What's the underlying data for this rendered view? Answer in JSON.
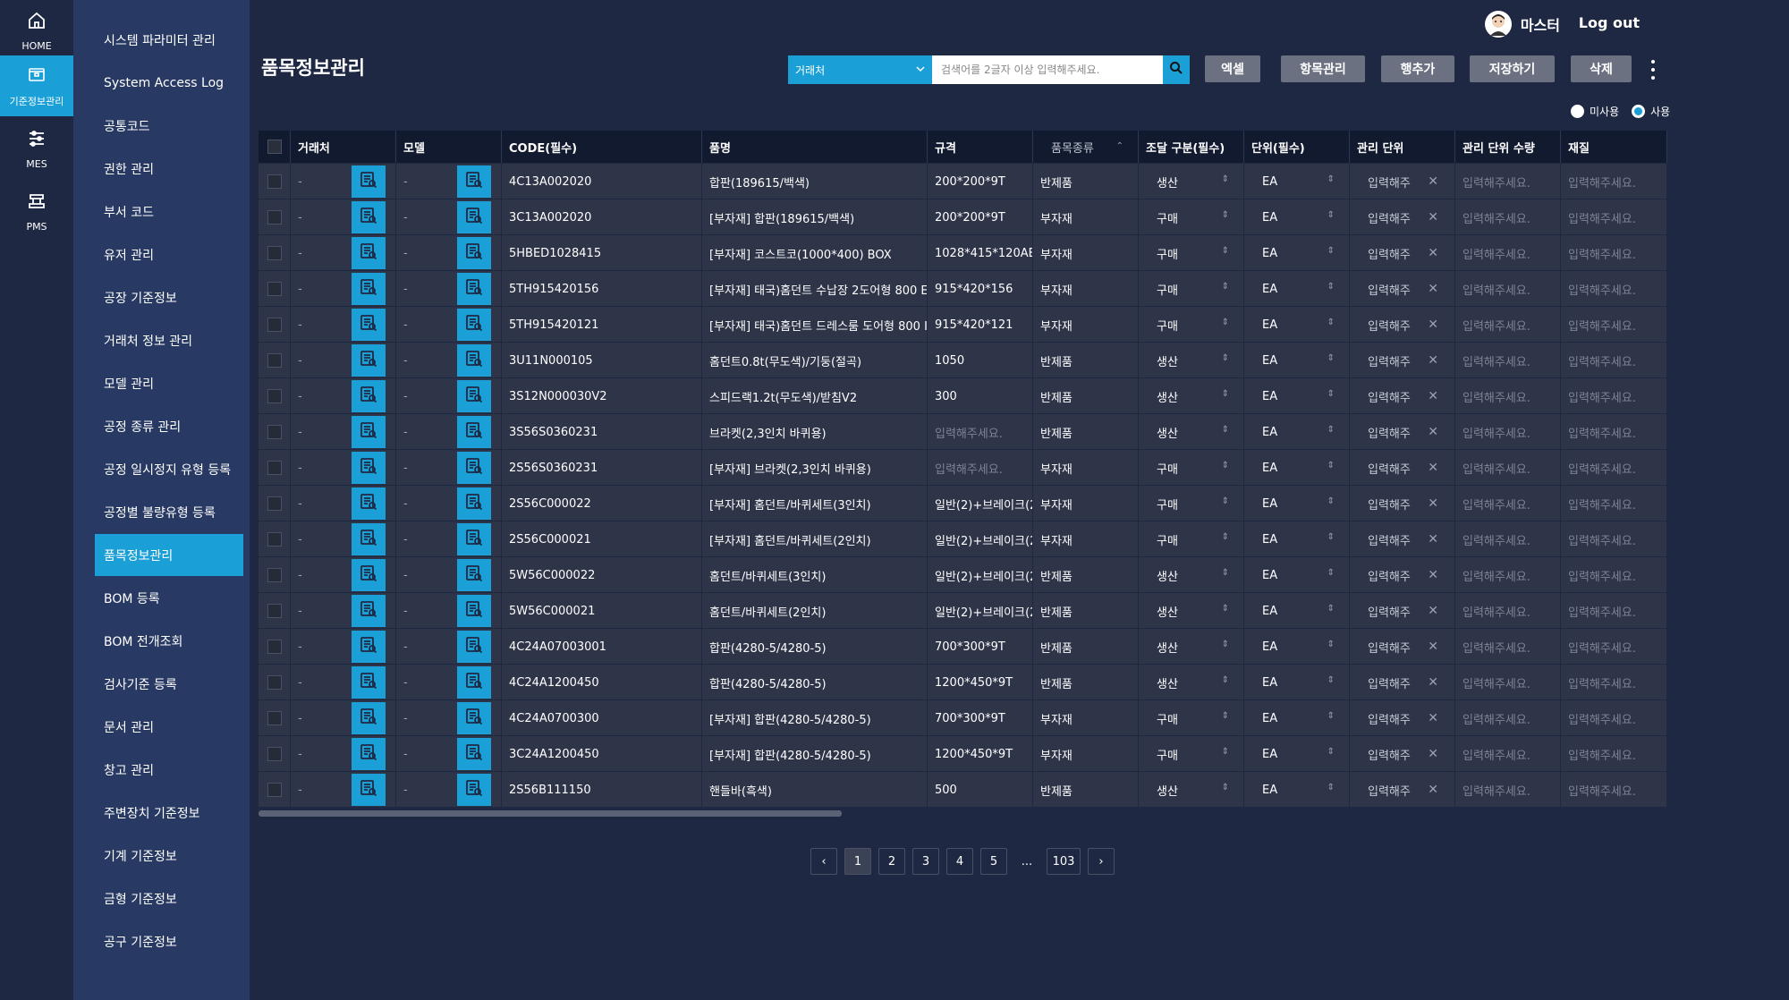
{
  "rail": [
    {
      "label": "HOME",
      "icon": "home-icon"
    },
    {
      "label": "기준정보관리",
      "icon": "folder-icon"
    },
    {
      "label": "MES",
      "icon": "sliders-icon"
    },
    {
      "label": "PMS",
      "icon": "machine-icon"
    }
  ],
  "sidebar": {
    "items": [
      "시스템 파라미터 관리",
      "System Access Log",
      "공통코드",
      "권한 관리",
      "부서 코드",
      "유저 관리",
      "공장 기준정보",
      "거래처 정보 관리",
      "모델 관리",
      "공정 종류 관리",
      "공정 일시정지 유형 등록",
      "공정별 불량유형 등록",
      "품목정보관리",
      "BOM 등록",
      "BOM 전개조회",
      "검사기준 등록",
      "문서 관리",
      "창고 관리",
      "주변장치 기준정보",
      "기계 기준정보",
      "금형 기준정보",
      "공구 기준정보"
    ]
  },
  "header": {
    "user_name": "마스터",
    "logout": "Log out"
  },
  "page_title": "품목정보관리",
  "search": {
    "select_value": "거래처",
    "placeholder": "검색어를 2글자 이상 입력해주세요."
  },
  "toolbar": {
    "excel": "엑셀",
    "columns": "항목관리",
    "add_row": "행추가",
    "save": "저장하기",
    "delete": "삭제"
  },
  "use_filter": {
    "unused": "미사용",
    "used": "사용"
  },
  "columns": [
    "거래처",
    "모델",
    "CODE(필수)",
    "품명",
    "규격",
    "품목종류",
    "조달 구분(필수)",
    "단위(필수)",
    "관리 단위",
    "관리 단위 수량",
    "재질"
  ],
  "rows": [
    {
      "customer": "-",
      "model": "-",
      "code": "4C13A002020",
      "name": "합판(189615/백색)",
      "spec": "200*200*9T",
      "type": "반제품",
      "procure": "생산",
      "unit": "EA"
    },
    {
      "customer": "-",
      "model": "-",
      "code": "3C13A002020",
      "name": "[부자재] 합판(189615/백색)",
      "spec": "200*200*9T",
      "type": "부자재",
      "procure": "구매",
      "unit": "EA"
    },
    {
      "customer": "-",
      "model": "-",
      "code": "5HBED1028415",
      "name": "[부자재] 코스트코(1000*400) BOX",
      "spec": "1028*415*120AB",
      "type": "부자재",
      "procure": "구매",
      "unit": "EA"
    },
    {
      "customer": "-",
      "model": "-",
      "code": "5TH915420156",
      "name": "[부자재] 태국)홈던트 수납장 2도어형 800 E",
      "spec": "915*420*156",
      "type": "부자재",
      "procure": "구매",
      "unit": "EA"
    },
    {
      "customer": "-",
      "model": "-",
      "code": "5TH915420121",
      "name": "[부자재] 태국)홈던트 드레스룸 도어형 800 I",
      "spec": "915*420*121",
      "type": "부자재",
      "procure": "구매",
      "unit": "EA"
    },
    {
      "customer": "-",
      "model": "-",
      "code": "3U11N000105",
      "name": "홈던트0.8t(무도색)/기둥(절곡)",
      "spec": "1050",
      "type": "반제품",
      "procure": "생산",
      "unit": "EA"
    },
    {
      "customer": "-",
      "model": "-",
      "code": "3S12N000030V2",
      "name": "스피드랙1.2t(무도색)/받침V2",
      "spec": "300",
      "type": "반제품",
      "procure": "생산",
      "unit": "EA"
    },
    {
      "customer": "-",
      "model": "-",
      "code": "3S56S0360231",
      "name": "브라켓(2,3인치 바퀴용)",
      "spec": "",
      "type": "반제품",
      "procure": "생산",
      "unit": "EA"
    },
    {
      "customer": "-",
      "model": "-",
      "code": "2S56S0360231",
      "name": "[부자재] 브라켓(2,3인치 바퀴용)",
      "spec": "",
      "type": "부자재",
      "procure": "구매",
      "unit": "EA"
    },
    {
      "customer": "-",
      "model": "-",
      "code": "2S56C000022",
      "name": "[부자재] 홈던트/바퀴세트(3인치)",
      "spec": "일반(2)+브레이크(2",
      "type": "부자재",
      "procure": "구매",
      "unit": "EA"
    },
    {
      "customer": "-",
      "model": "-",
      "code": "2S56C000021",
      "name": "[부자재] 홈던트/바퀴세트(2인치)",
      "spec": "일반(2)+브레이크(2",
      "type": "부자재",
      "procure": "구매",
      "unit": "EA"
    },
    {
      "customer": "-",
      "model": "-",
      "code": "5W56C000022",
      "name": "홈던트/바퀴세트(3인치)",
      "spec": "일반(2)+브레이크(2",
      "type": "반제품",
      "procure": "생산",
      "unit": "EA"
    },
    {
      "customer": "-",
      "model": "-",
      "code": "5W56C000021",
      "name": "홈던트/바퀴세트(2인치)",
      "spec": "일반(2)+브레이크(2",
      "type": "반제품",
      "procure": "생산",
      "unit": "EA"
    },
    {
      "customer": "-",
      "model": "-",
      "code": "4C24A07003001",
      "name": "합판(4280-5/4280-5)",
      "spec": "700*300*9T",
      "type": "반제품",
      "procure": "생산",
      "unit": "EA"
    },
    {
      "customer": "-",
      "model": "-",
      "code": "4C24A1200450",
      "name": "합판(4280-5/4280-5)",
      "spec": "1200*450*9T",
      "type": "반제품",
      "procure": "생산",
      "unit": "EA"
    },
    {
      "customer": "-",
      "model": "-",
      "code": "4C24A0700300",
      "name": "[부자재] 합판(4280-5/4280-5)",
      "spec": "700*300*9T",
      "type": "부자재",
      "procure": "구매",
      "unit": "EA"
    },
    {
      "customer": "-",
      "model": "-",
      "code": "3C24A1200450",
      "name": "[부자재] 합판(4280-5/4280-5)",
      "spec": "1200*450*9T",
      "type": "부자재",
      "procure": "구매",
      "unit": "EA"
    },
    {
      "customer": "-",
      "model": "-",
      "code": "2S56B111150",
      "name": "핸들바(흑색)",
      "spec": "500",
      "type": "반제품",
      "procure": "생산",
      "unit": "EA"
    }
  ],
  "placeholders": {
    "spec": "입력해주세요.",
    "mgmt_unit": "입력해주",
    "mgmt_qty": "입력해주세요.",
    "material": "입력해주세요."
  },
  "pagination": {
    "prev": "‹",
    "pages": [
      "1",
      "2",
      "3",
      "4",
      "5"
    ],
    "ellipsis": "...",
    "last": "103",
    "next": "›",
    "current": "1"
  }
}
